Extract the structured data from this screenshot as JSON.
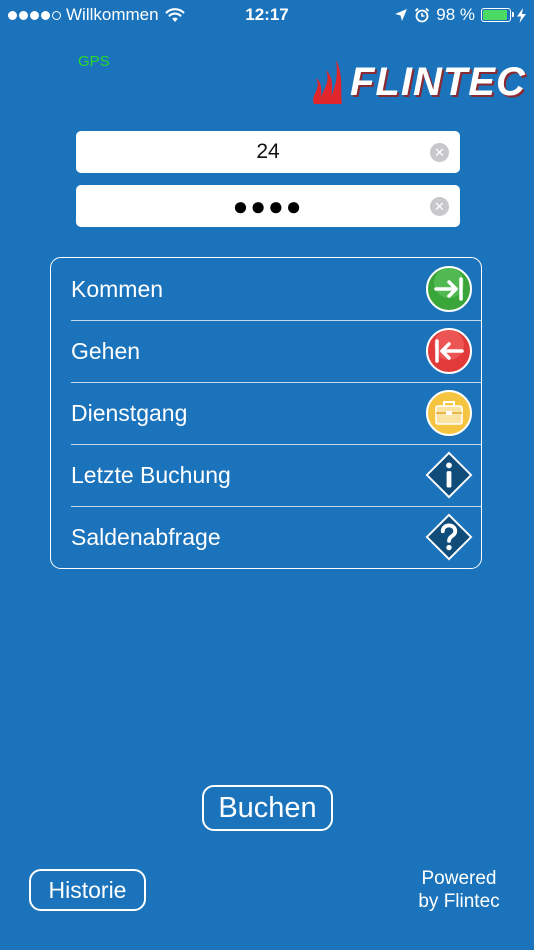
{
  "status_bar": {
    "carrier": "Willkommen",
    "time": "12:17",
    "battery_percent": "98 %",
    "battery_level": 0.98
  },
  "header": {
    "gps_label": "GPS",
    "logo_text": "FLINTEC"
  },
  "login": {
    "id_value": "24",
    "pin_masked": "●●●●"
  },
  "menu": {
    "items": [
      {
        "label": "Kommen",
        "icon": "arrow-in-icon",
        "color": "#3aa63a"
      },
      {
        "label": "Gehen",
        "icon": "arrow-out-icon",
        "color": "#e23a3a"
      },
      {
        "label": "Dienstgang",
        "icon": "briefcase-icon",
        "color": "#f5c542"
      },
      {
        "label": "Letzte Buchung",
        "icon": "info-icon",
        "color": "#0f4c7a"
      },
      {
        "label": "Saldenabfrage",
        "icon": "question-icon",
        "color": "#0f4c7a"
      }
    ]
  },
  "actions": {
    "book_label": "Buchen",
    "history_label": "Historie"
  },
  "footer": {
    "powered_line1": "Powered",
    "powered_line2": "by Flintec"
  }
}
